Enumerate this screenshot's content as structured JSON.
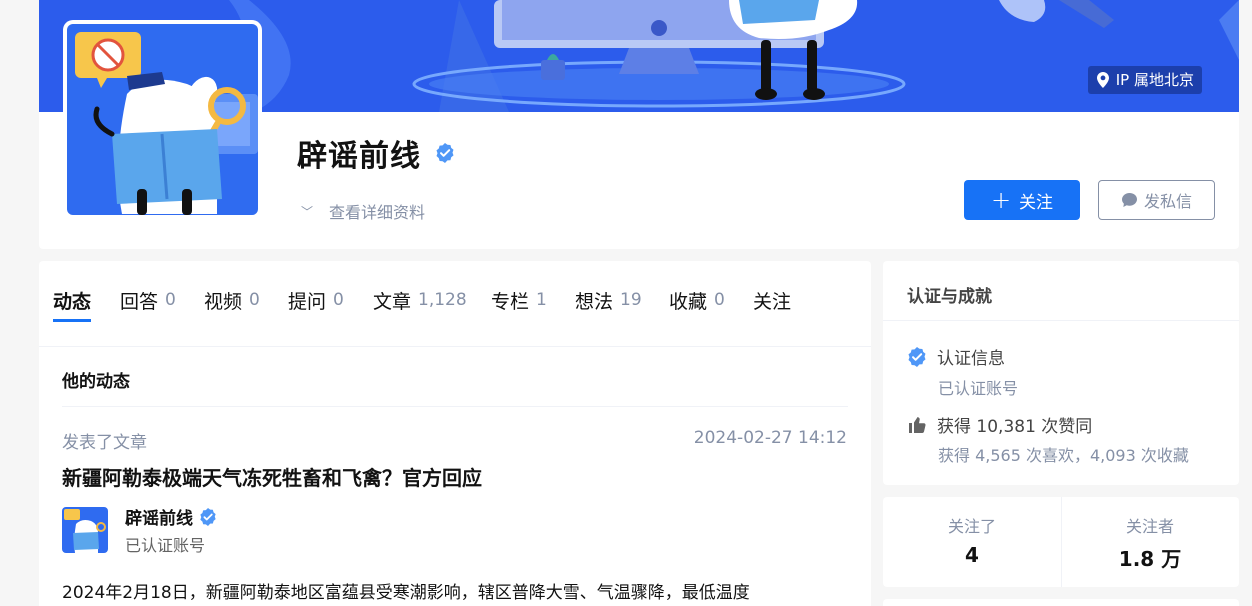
{
  "profile": {
    "name": "辟谣前线",
    "ip_location": "IP 属地北京",
    "detail_link": "查看详细资料",
    "follow_label": "关注",
    "message_label": "发私信"
  },
  "tabs": [
    {
      "label": "动态",
      "count": ""
    },
    {
      "label": "回答",
      "count": "0"
    },
    {
      "label": "视频",
      "count": "0"
    },
    {
      "label": "提问",
      "count": "0"
    },
    {
      "label": "文章",
      "count": "1,128"
    },
    {
      "label": "专栏",
      "count": "1"
    },
    {
      "label": "想法",
      "count": "19"
    },
    {
      "label": "收藏",
      "count": "0"
    },
    {
      "label": "关注",
      "count": ""
    }
  ],
  "feed": {
    "section_title": "他的动态",
    "item": {
      "action": "发表了文章",
      "time": "2024-02-27 14:12",
      "title": "新疆阿勒泰极端天气冻死牲畜和飞禽？官方回应",
      "author_name": "辟谣前线",
      "author_badge": "已认证账号",
      "excerpt": "2024年2月18日，新疆阿勒泰地区富蕴县受寒潮影响，辖区普降大雪、气温骤降，最低温度"
    }
  },
  "sidebar": {
    "title": "认证与成就",
    "verify_label": "认证信息",
    "verify_sub": "已认证账号",
    "likes_label": "获得 10,381 次赞同",
    "likes_sub": "获得 4,565 次喜欢，4,093 次收藏"
  },
  "stats": {
    "following_label": "关注了",
    "following_value": "4",
    "followers_label": "关注者",
    "followers_value": "1.8 万"
  },
  "colors": {
    "accent": "#1772f6",
    "banner": "#2f63f0",
    "muted": "#8590a6"
  }
}
